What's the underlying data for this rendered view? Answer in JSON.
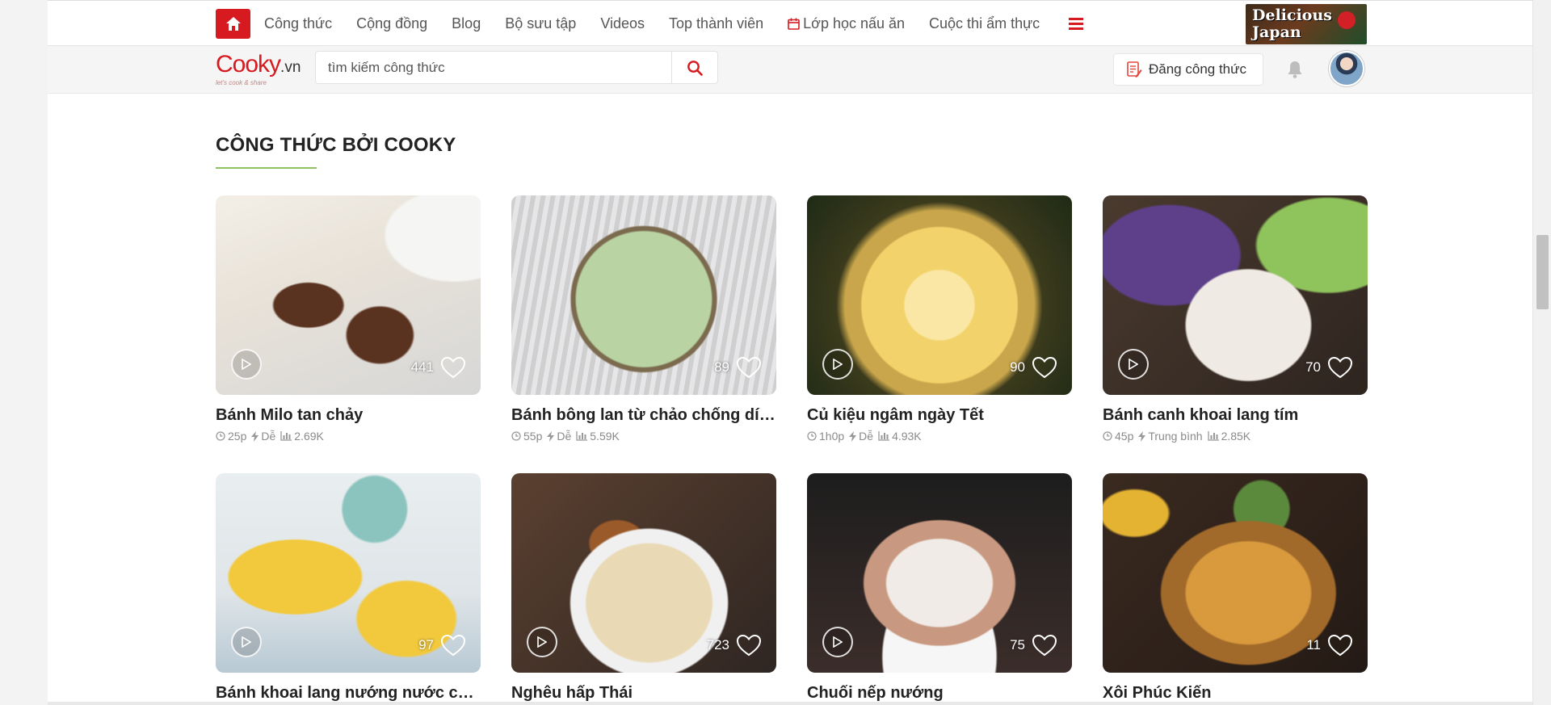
{
  "nav": {
    "items": [
      "Công thức",
      "Cộng đồng",
      "Blog",
      "Bộ sưu tập",
      "Videos",
      "Top thành viên",
      "Lớp học nấu ăn",
      "Cuộc thi ẩm thực"
    ],
    "banner_text": "Delicious Japan",
    "accent_color": "#d71920"
  },
  "header": {
    "logo_text": "Cooky",
    "logo_suffix": ".vn",
    "logo_tagline": "let's cook & share",
    "search_placeholder": "tìm kiếm công thức",
    "post_button": "Đăng công thức"
  },
  "section": {
    "title": "CÔNG THỨC BỞI COOKY",
    "underline_color": "#8cc35c"
  },
  "recipes": [
    {
      "title": "Bánh Milo tan chảy",
      "time": "25p",
      "level": "Dễ",
      "views": "2.69K",
      "likes": "441"
    },
    {
      "title": "Bánh bông lan từ chảo chống dính",
      "time": "55p",
      "level": "Dễ",
      "views": "5.59K",
      "likes": "89"
    },
    {
      "title": "Củ kiệu ngâm ngày Tết",
      "time": "1h0p",
      "level": "Dễ",
      "views": "4.93K",
      "likes": "90"
    },
    {
      "title": "Bánh canh khoai lang tím",
      "time": "45p",
      "level": "Trung bình",
      "views": "2.85K",
      "likes": "70"
    },
    {
      "title": "Bánh khoai lang nướng nước cốt dừa",
      "time": "",
      "level": "",
      "views": "",
      "likes": "97"
    },
    {
      "title": "Nghêu hấp Thái",
      "time": "",
      "level": "",
      "views": "",
      "likes": "723"
    },
    {
      "title": "Chuối nếp nướng",
      "time": "",
      "level": "",
      "views": "",
      "likes": "75"
    },
    {
      "title": "Xôi Phúc Kiến",
      "time": "",
      "level": "",
      "views": "",
      "likes": "11"
    }
  ]
}
